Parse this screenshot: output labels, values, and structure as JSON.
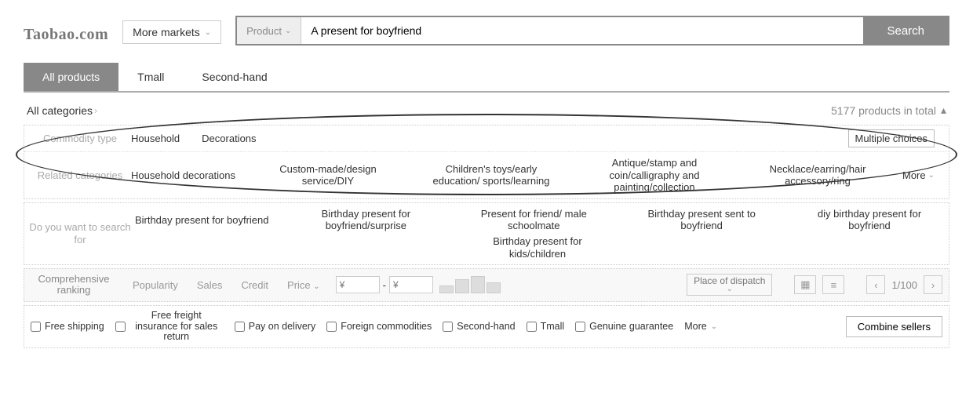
{
  "header": {
    "logo": "Taobao.com",
    "more_markets": "More markets",
    "search_scope": "Product",
    "search_value": "A present for boyfriend",
    "search_button": "Search"
  },
  "tabs": {
    "all_products": "All products",
    "tmall": "Tmall",
    "second_hand": "Second-hand"
  },
  "summary": {
    "all_categories": "All categories",
    "total": "5177 products in total"
  },
  "filters": {
    "commodity_type": {
      "label": "Commodity type",
      "values": [
        "Household",
        "Decorations"
      ],
      "multiple": "Multiple choices"
    },
    "related_categories": {
      "label": "Related categories",
      "values": [
        "Household decorations",
        "Custom-made/design service/DIY",
        "Children's toys/early education/ sports/learning",
        "Antique/stamp and coin/calligraphy and painting/collection",
        "Necklace/earring/hair accessory/ring"
      ],
      "more": "More"
    },
    "search_suggest": {
      "label": "Do you want to search for",
      "values": [
        "Birthday present for boyfriend",
        "Birthday present for boyfriend/surprise",
        "Present for friend/ male schoolmate",
        "Birthday present sent to boyfriend",
        "diy birthday present for boyfriend",
        "Birthday present for kids/children"
      ]
    }
  },
  "sort": {
    "label": "Comprehensive ranking",
    "popularity": "Popularity",
    "sales": "Sales",
    "credit": "Credit",
    "price": "Price",
    "currency": "¥",
    "dispatch": "Place of dispatch",
    "page": "1/100"
  },
  "checks": {
    "free_shipping": "Free shipping",
    "freight_insurance": "Free freight insurance for sales return",
    "pay_on_delivery": "Pay on delivery",
    "foreign": "Foreign commodities",
    "second_hand": "Second-hand",
    "tmall": "Tmall",
    "genuine": "Genuine guarantee",
    "more": "More",
    "combine": "Combine sellers"
  }
}
